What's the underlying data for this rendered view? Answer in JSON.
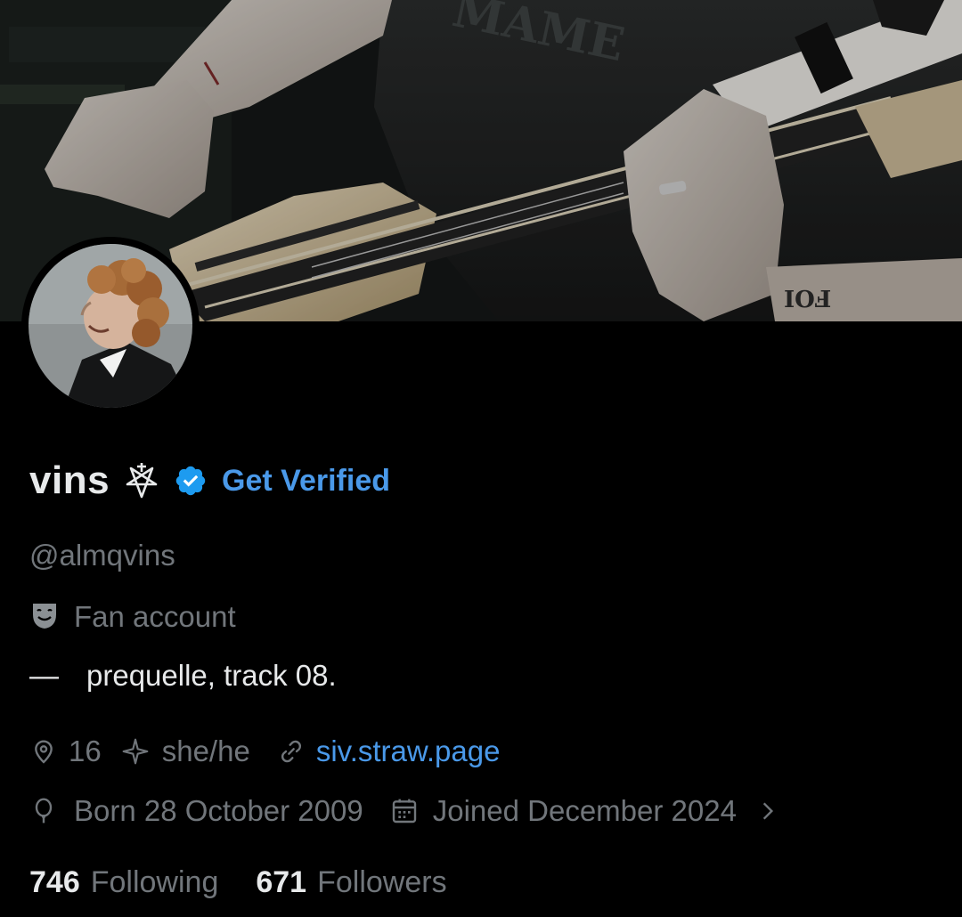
{
  "profile": {
    "display_name": "vins",
    "name_glyph": "pentagram-cross-icon",
    "verified_icon": "verified-badge-icon",
    "get_verified_label": "Get Verified",
    "handle": "@almqvins",
    "category_icon": "theater-masks-icon",
    "category": "Fan account",
    "bio_dash": "—",
    "bio_text": "prequelle, track 08.",
    "location_icon": "location-pin-icon",
    "location": "16",
    "sparkle_icon": "sparkle-icon",
    "pronouns": "she/he",
    "link_icon": "link-icon",
    "website": "siv.straw.page",
    "birthday_icon": "balloon-icon",
    "birthday": "Born 28 October 2009",
    "joined_icon": "calendar-icon",
    "joined": "Joined December 2024",
    "chevron_icon": "chevron-right-icon"
  },
  "stats": {
    "following_count": "746",
    "following_label": "Following",
    "followers_count": "671",
    "followers_label": "Followers"
  },
  "colors": {
    "background": "#000000",
    "primary_text": "#e7e9ea",
    "secondary_text": "#71767b",
    "accent_blue": "#4a99e9"
  }
}
